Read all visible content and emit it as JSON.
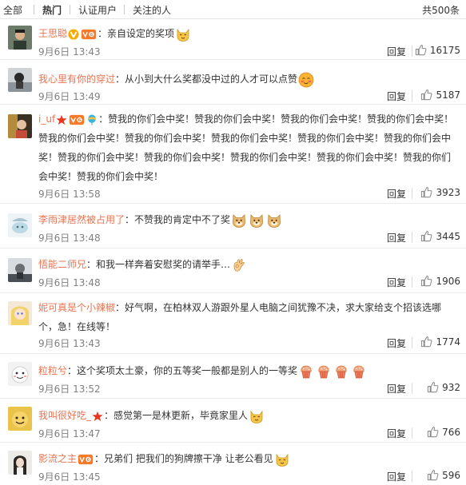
{
  "tabs": [
    "全部",
    "热门",
    "认证用户",
    "关注的人"
  ],
  "active_tab": "热门",
  "total": "共500条",
  "reply_label": "回复",
  "colors": {
    "username": "#eb7350",
    "time": "#808080",
    "text": "#333333"
  },
  "comments": [
    {
      "user": "王思聪",
      "text": "：亲自设定的奖项",
      "time": "9月6日 13:43",
      "likes": "16175"
    },
    {
      "user": "我心里有你的穿过",
      "text": "：从小到大什么奖都没中过的人才可以点赞",
      "time": "9月6日 13:49",
      "likes": "5187"
    },
    {
      "user": "i_uf",
      "text": "：赞我的你们会中奖！赞我的你们会中奖！赞我的你们会中奖！赞我的你们会中奖！赞我的你们会中奖！赞我的你们会中奖！赞我的你们会中奖！赞我的你们会中奖！赞我的你们会中奖！赞我的你们会中奖！赞我的你们会中奖！赞我的你们会中奖！赞我的你们会中奖！赞我的你们会中奖！赞我的你们会中奖！",
      "time": "9月6日 13:58",
      "likes": "3923"
    },
    {
      "user": "李雨津居然被占用了",
      "text": "：不赞我的肯定中不了奖",
      "time": "9月6日 13:48",
      "likes": "3445"
    },
    {
      "user": "悟能二师兄",
      "text": "：和我一样奔着安慰奖的请举手…",
      "time": "9月6日 13:48",
      "likes": "1906"
    },
    {
      "user": "妮可真是个小辣椒",
      "text": "：好气啊，在柏林双人游跟外星人电脑之间犹豫不决，求大家给支个招该选哪个，急！在线等！",
      "time": "9月6日 13:43",
      "likes": "1774"
    },
    {
      "user": "粒粒兮",
      "text": "：这个奖项太土豪，你的五等奖一般都是别人的一等奖",
      "time": "9月6日 13:52",
      "likes": "932"
    },
    {
      "user": "我叫很好吃_",
      "text": "：感觉第一是林更新，毕竟家里人",
      "time": "9月6日 13:47",
      "likes": "766"
    },
    {
      "user": "影流之主",
      "text": "：兄弟们 把我们的狗牌擦干净 让老公看见",
      "time": "9月6日 13:45",
      "likes": "596"
    }
  ],
  "icons": {
    "badges": [
      "vip-v-icon",
      "vip-level-icon",
      "star-badge-icon",
      "balloon-icon"
    ],
    "emoji": [
      "cat-smile-emoji",
      "blush-emoji",
      "doge-emoji",
      "ok-hand-emoji",
      "cake-emoji",
      "thumbs-up-icon"
    ]
  }
}
